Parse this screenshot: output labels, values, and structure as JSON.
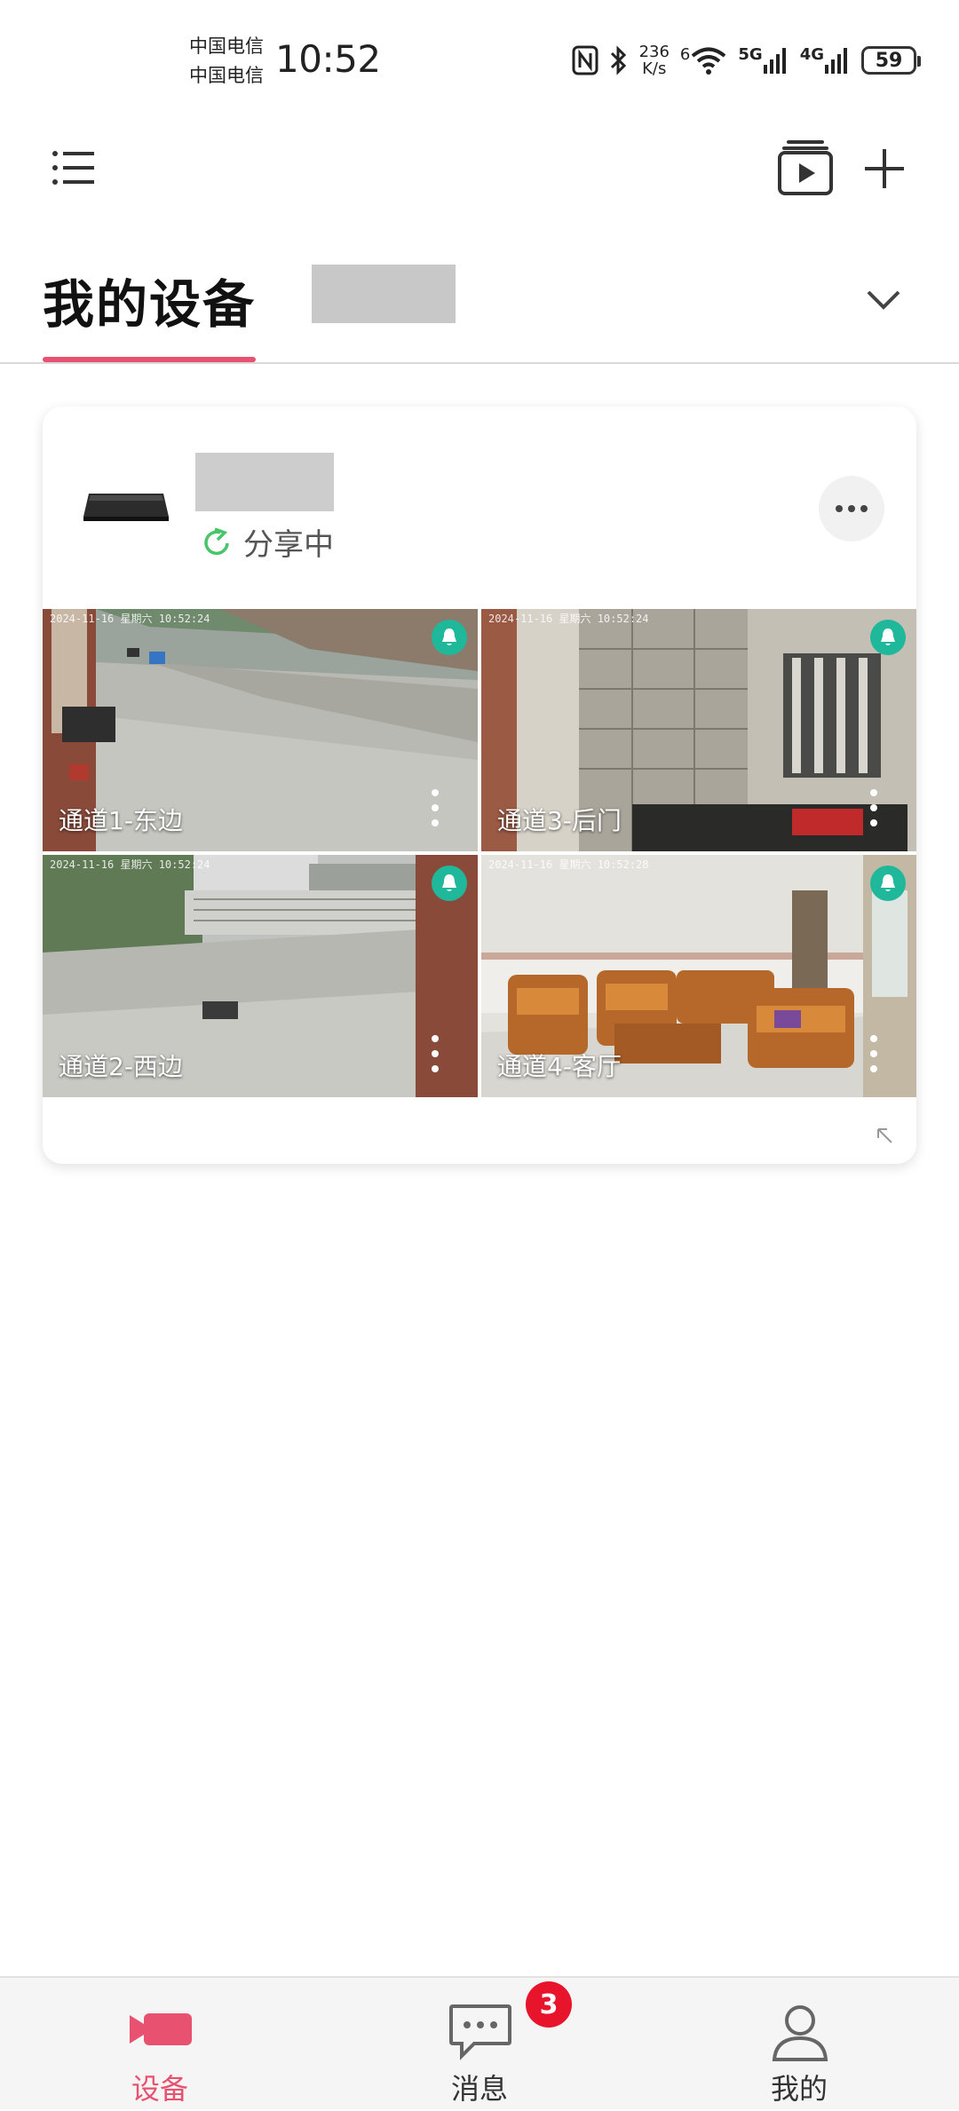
{
  "status_bar": {
    "carrier_1": "中国电信",
    "carrier_2": "中国电信",
    "time": "10:52",
    "net_speed_value": "236",
    "net_speed_unit": "K/s",
    "wifi_label": "6",
    "signal_1": "5G",
    "signal_2": "4G",
    "battery": "59"
  },
  "toolbar": {
    "icons": [
      "menu-icon",
      "playlist-play-icon",
      "plus-icon"
    ]
  },
  "tabs": {
    "active_tab": "我的设备",
    "accent_color": "#e8516f"
  },
  "device": {
    "share_status": "分享中",
    "channels": [
      {
        "label": "通道1-东边",
        "timestamp": "2024-11-16 星期六 10:52:24"
      },
      {
        "label": "通道3-后门",
        "timestamp": "2024-11-16 星期六 10:52:24"
      },
      {
        "label": "通道2-西边",
        "timestamp": "2024-11-16 星期六 10:52:24"
      },
      {
        "label": "通道4-客厅",
        "timestamp": "2024-11-16 星期六 10:52:28"
      }
    ],
    "alarm_color": "#1fb89a"
  },
  "bottom_nav": {
    "items": [
      {
        "label": "设备",
        "icon": "camera-icon",
        "active": true
      },
      {
        "label": "消息",
        "icon": "chat-icon",
        "active": false
      },
      {
        "label": "我的",
        "icon": "person-icon",
        "active": false
      }
    ],
    "message_badge": "3"
  }
}
